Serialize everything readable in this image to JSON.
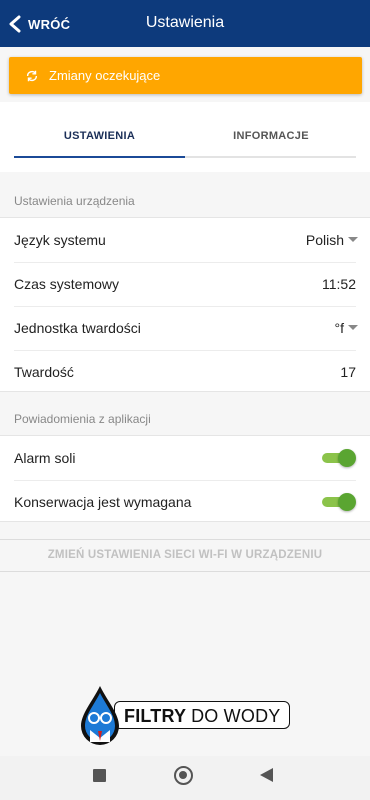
{
  "header": {
    "back_label": "WRÓĆ",
    "title": "Ustawienia",
    "background": "#0d3a7c"
  },
  "banner": {
    "text": "Zmiany oczekujące",
    "icon": "sync-icon",
    "color": "#ffa600"
  },
  "tabs": [
    {
      "label": "USTAWIENIA",
      "active": true
    },
    {
      "label": "INFORMACJE",
      "active": false
    }
  ],
  "device_settings": {
    "section_label": "Ustawienia urządzenia",
    "items": [
      {
        "label": "Język systemu",
        "value": "Polish",
        "dropdown": true
      },
      {
        "label": "Czas systemowy",
        "value": "11:52",
        "dropdown": false
      },
      {
        "label": "Jednostka twardości",
        "value": "°f",
        "dropdown": true
      },
      {
        "label": "Twardość",
        "value": "17",
        "dropdown": false
      }
    ]
  },
  "notifications": {
    "section_label": "Powiadomienia z aplikacji",
    "items": [
      {
        "label": "Alarm soli",
        "on": true
      },
      {
        "label": "Konserwacja jest wymagana",
        "on": true
      }
    ],
    "toggle_color": "#5aa531"
  },
  "wifi_button": "ZMIEŃ USTAWIENIA SIECI WI-FI W URZĄDZENIU",
  "logo": {
    "word_bold": "FILTRY",
    "word_light": "DO WODY"
  },
  "system_nav": [
    "recents-icon",
    "home-icon",
    "back-icon"
  ]
}
